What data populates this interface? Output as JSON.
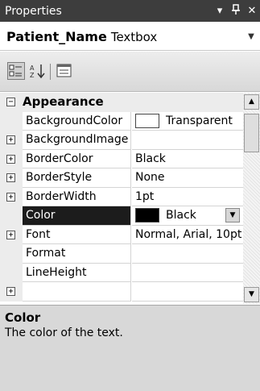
{
  "titlebar": {
    "title": "Properties",
    "dropdown_icon": "▾",
    "pin_icon": "ꟷ",
    "close_icon": "✕"
  },
  "object": {
    "name": "Patient_Name",
    "type": "Textbox"
  },
  "toolbar": {
    "categorized_icon": "categorized-icon",
    "alphabetical_icon": "alphabetical-icon",
    "property_pages_icon": "property-pages-icon"
  },
  "grid": {
    "category": {
      "label": "Appearance",
      "expander": "⊟"
    },
    "rows": [
      {
        "name": "BackgroundColor",
        "value": "Transparent",
        "expandable": false,
        "swatch": "#ffffff",
        "selected": false
      },
      {
        "name": "BackgroundImage",
        "value": "",
        "expandable": true,
        "selected": false
      },
      {
        "name": "BorderColor",
        "value": "Black",
        "expandable": true,
        "selected": false
      },
      {
        "name": "BorderStyle",
        "value": "None",
        "expandable": true,
        "selected": false
      },
      {
        "name": "BorderWidth",
        "value": "1pt",
        "expandable": true,
        "selected": false
      },
      {
        "name": "Color",
        "value": "Black",
        "expandable": false,
        "swatch": "#000000",
        "selected": true,
        "dropdown": true
      },
      {
        "name": "Font",
        "value": "Normal, Arial, 10pt",
        "expandable": true,
        "selected": false
      },
      {
        "name": "Format",
        "value": "",
        "expandable": false,
        "selected": false
      },
      {
        "name": "LineHeight",
        "value": "",
        "expandable": false,
        "selected": false
      },
      {
        "name": "",
        "value": "",
        "expandable": true,
        "selected": false
      }
    ]
  },
  "description": {
    "title": "Color",
    "text": "The color of the text."
  },
  "colors": {
    "titlebar": "#3d3d3d",
    "selected_row": "#1c1c1c",
    "gutter": "#ececec",
    "description_bg": "#d8d8d8"
  }
}
